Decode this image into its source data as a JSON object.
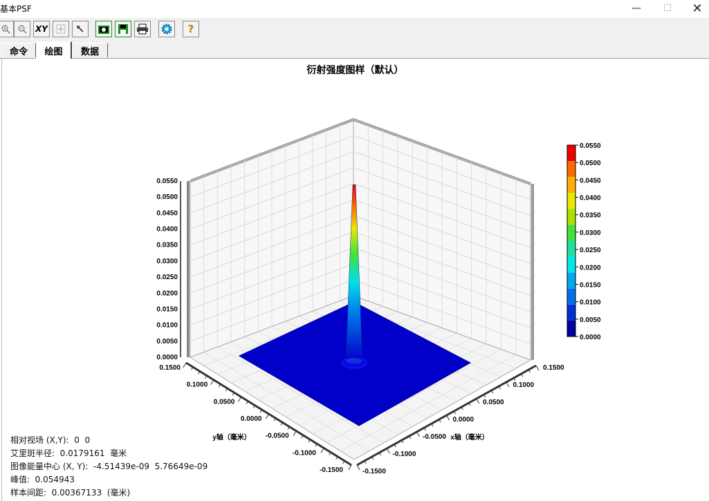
{
  "window": {
    "title": "基本PSF"
  },
  "toolbar": {
    "buttons": [
      {
        "icon": "zoom-in-icon"
      },
      {
        "icon": "zoom-out-icon"
      },
      {
        "icon": "xy-axis-icon",
        "label": "XY"
      },
      {
        "icon": "zoom-fit-icon"
      },
      {
        "icon": "pointer-icon"
      },
      {
        "icon": "camera-icon"
      },
      {
        "icon": "save-icon"
      },
      {
        "icon": "print-icon"
      },
      {
        "icon": "settings-gear-icon"
      },
      {
        "icon": "help-icon",
        "label": "?"
      }
    ]
  },
  "tabs": [
    {
      "label": "命令"
    },
    {
      "label": "绘图",
      "active": true
    },
    {
      "label": "数据"
    }
  ],
  "chart_data": {
    "type": "surface3d",
    "title": "衍射强度图样（默认）",
    "xlabel": "x轴（毫米）",
    "ylabel": "y轴（毫米）",
    "x_ticks": [
      "-0.1500",
      "-0.1000",
      "-0.0500",
      "0.0000",
      "0.0500",
      "0.1000",
      "0.1500"
    ],
    "y_ticks": [
      "-0.1500",
      "-0.1000",
      "-0.0500",
      "0.0000",
      "0.0500",
      "0.1000",
      "0.1500"
    ],
    "z_ticks": [
      "0.0000",
      "0.0050",
      "0.0100",
      "0.0150",
      "0.0200",
      "0.0250",
      "0.0300",
      "0.0350",
      "0.0400",
      "0.0450",
      "0.0500",
      "0.0550"
    ],
    "xlim": [
      -0.15,
      0.15
    ],
    "ylim": [
      -0.15,
      0.15
    ],
    "zlim": [
      0,
      0.055
    ],
    "peak": {
      "x": 0.0,
      "y": 0.0,
      "z": 0.054943
    },
    "colorbar": {
      "labels": [
        "0.0550",
        "0.0500",
        "0.0450",
        "0.0400",
        "0.0350",
        "0.0300",
        "0.0250",
        "0.0200",
        "0.0150",
        "0.0100",
        "0.0050",
        "0.0000"
      ],
      "colors": [
        "#ee0000",
        "#ff6a00",
        "#ffb000",
        "#e8e800",
        "#a8e000",
        "#40e040",
        "#20e0a0",
        "#00e8e8",
        "#00a8f0",
        "#0070e8",
        "#0030d8",
        "#0000a0"
      ]
    }
  },
  "info": {
    "lines": [
      "相对视场 (X,Y):  0  0",
      "艾里斑半径:  0.0179161  毫米",
      "图像能量中心 (X, Y):  -4.51439e-09  5.76649e-09",
      "峰值:  0.054943",
      "样本间距:  0.00367133  (毫米)"
    ]
  }
}
